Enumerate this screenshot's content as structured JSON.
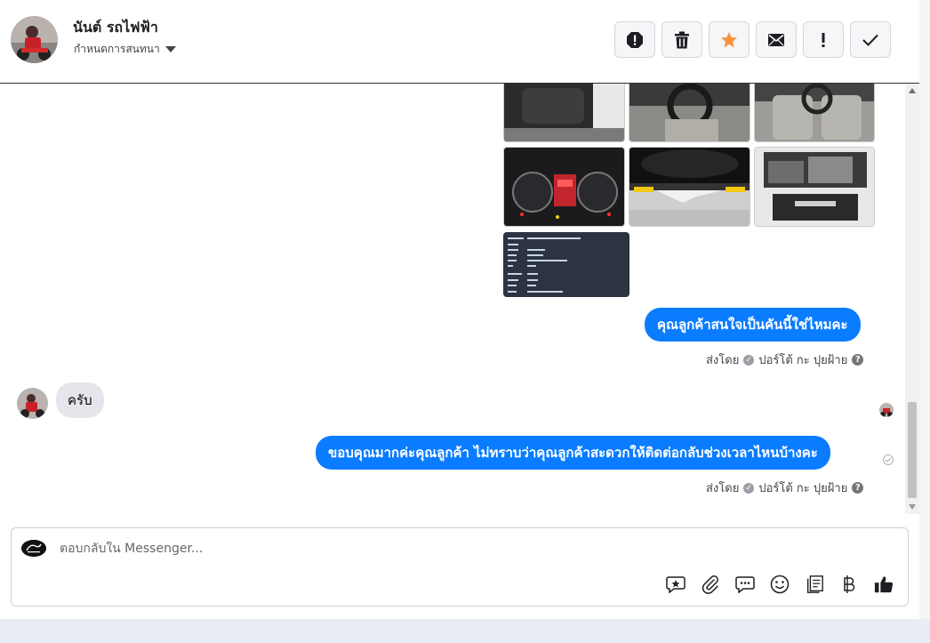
{
  "header": {
    "contact_name": "นันต์ รถไฟฟ้า",
    "assign_label": "กำหนดการสนทนา"
  },
  "actions": [
    {
      "name": "mark-spam-button",
      "icon": "alert-octagon-icon"
    },
    {
      "name": "delete-button",
      "icon": "trash-icon"
    },
    {
      "name": "star-button",
      "icon": "star-icon"
    },
    {
      "name": "mark-unread-button",
      "icon": "envelope-icon"
    },
    {
      "name": "follow-up-button",
      "icon": "exclamation-icon"
    },
    {
      "name": "mark-done-button",
      "icon": "check-icon"
    }
  ],
  "colors": {
    "accent": "#0a7cff",
    "star": "#f7923a"
  },
  "messages": {
    "out1": "คุณลูกค้าสนใจเป็นคันนี้ใช่ไหมคะ",
    "sent_by_prefix": "ส่งโดย",
    "sent_by_name": "ปอร์โต้ กะ ปุยฝ้าย",
    "in1": "ครับ",
    "out2": "ขอบคุณมากค่ะคุณลูกค้า ไม่ทราบว่าคุณลูกค้าสะดวกให้ติดต่อกลับช่วงเวลาไหนบ้างคะ"
  },
  "composer": {
    "placeholder": "ตอบกลับใน Messenger...",
    "tools": [
      "saved-reply-icon",
      "attachment-icon",
      "chat-bubble-icon",
      "emoji-icon",
      "catalog-icon",
      "baht-icon",
      "like-icon"
    ]
  }
}
